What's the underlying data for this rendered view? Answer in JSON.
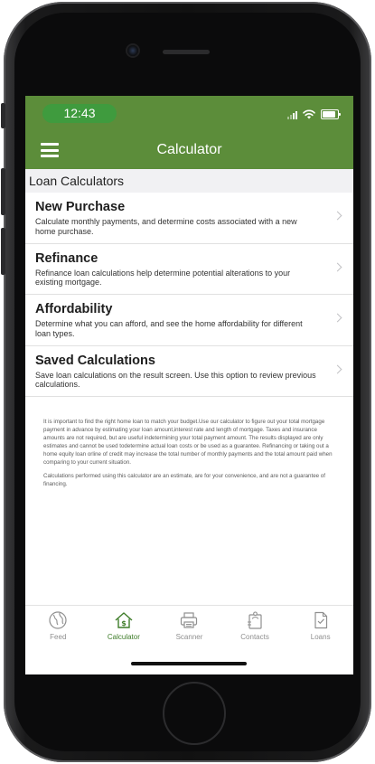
{
  "status": {
    "time": "12:43"
  },
  "nav": {
    "title": "Calculator"
  },
  "section": {
    "header": "Loan Calculators"
  },
  "items": [
    {
      "title": "New Purchase",
      "description": "Calculate monthly payments, and determine costs associated with a new home purchase."
    },
    {
      "title": "Refinance",
      "description": "Refinance loan calculations help determine potential alterations to your existing mortgage."
    },
    {
      "title": "Affordability",
      "description": "Determine what you can afford, and see the home affordability for different loan types."
    },
    {
      "title": "Saved Calculations",
      "description": "Save loan calculations on the result screen. Use this option to review previous calculations."
    }
  ],
  "disclaimer": {
    "paragraph1": "It is important to find the right home loan to match your budget.Use our calculator to figure out your total mortgage payment in advance by estimating your loan amount,interest rate and length of mortgage. Taxes and insurance amounts are not required, but are useful indetermining your total payment amount. The results displayed are only estimates and cannot be used todetermine actual loan costs or be used as a guarantee. Refinancing or taking out a home equity loan orline of credit may increase the total number of monthly payments and the total amount paid when comparing to your current situation.",
    "paragraph2": "Calculations performed using this calculator are an estimate, are for your convenience, and are not a guarantee of financing."
  },
  "tabs": [
    {
      "label": "Feed",
      "icon": "globe-icon"
    },
    {
      "label": "Calculator",
      "icon": "house-dollar-icon",
      "active": true
    },
    {
      "label": "Scanner",
      "icon": "printer-icon"
    },
    {
      "label": "Contacts",
      "icon": "contacts-icon"
    },
    {
      "label": "Loans",
      "icon": "document-check-icon"
    }
  ],
  "colors": {
    "brand_green": "#5c8d3a",
    "time_pill": "#3f9b3e",
    "active_tab": "#3f7d2a"
  }
}
